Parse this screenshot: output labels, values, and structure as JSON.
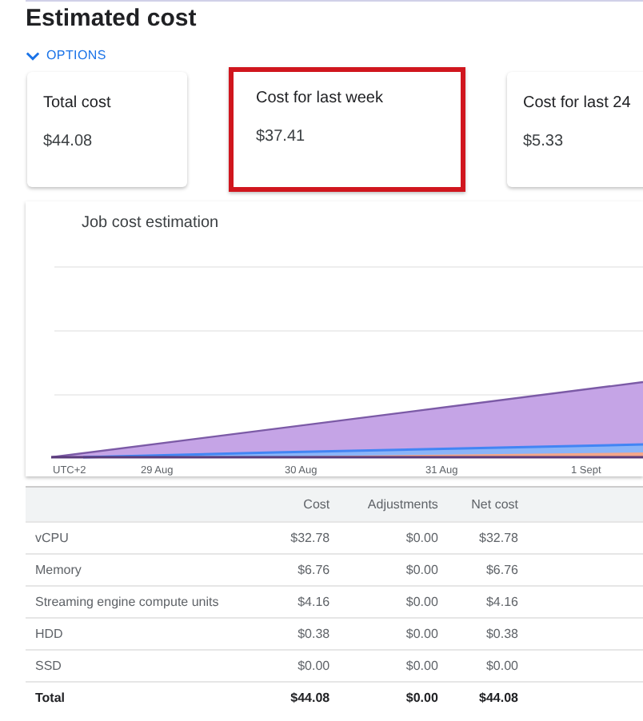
{
  "title": "Estimated cost",
  "options": {
    "label": "OPTIONS",
    "expanded": true
  },
  "cards": [
    {
      "label": "Total cost",
      "value": "$44.08",
      "highlighted": false
    },
    {
      "label": "Cost for last week",
      "value": "$37.41",
      "highlighted": true
    },
    {
      "label": "Cost for last 24",
      "value": "$5.33",
      "highlighted": false
    }
  ],
  "chart": {
    "title": "Job cost estimation",
    "x_labels": [
      "UTC+2",
      "29 Aug",
      "30 Aug",
      "31 Aug",
      "1 Sept"
    ]
  },
  "table": {
    "columns": [
      "Cost",
      "Adjustments",
      "Net cost"
    ],
    "rows": [
      {
        "name": "vCPU",
        "cells": [
          "$32.78",
          "$0.00",
          "$32.78"
        ],
        "total": false
      },
      {
        "name": "Memory",
        "cells": [
          "$6.76",
          "$0.00",
          "$6.76"
        ],
        "total": false
      },
      {
        "name": "Streaming engine compute units",
        "cells": [
          "$4.16",
          "$0.00",
          "$4.16"
        ],
        "total": false
      },
      {
        "name": "HDD",
        "cells": [
          "$0.38",
          "$0.00",
          "$0.38"
        ],
        "total": false
      },
      {
        "name": "SSD",
        "cells": [
          "$0.00",
          "$0.00",
          "$0.00"
        ],
        "total": false
      },
      {
        "name": "Total",
        "cells": [
          "$44.08",
          "$0.00",
          "$44.08"
        ],
        "total": true
      }
    ]
  }
}
